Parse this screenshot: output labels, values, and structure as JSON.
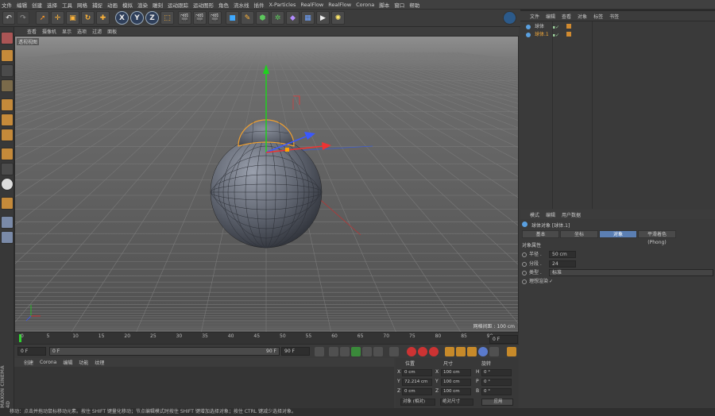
{
  "menu": [
    "文件",
    "编辑",
    "创建",
    "选择",
    "工具",
    "网格",
    "捕捉",
    "动画",
    "模拟",
    "渲染",
    "雕刻",
    "运动跟踪",
    "运动图形",
    "角色",
    "流水线",
    "插件",
    "X-Particles",
    "RealFlow",
    "RealFlow",
    "Corona",
    "脚本",
    "窗口",
    "帮助"
  ],
  "toolbar": {
    "axis_x": "X",
    "axis_y": "Y",
    "axis_z": "Z"
  },
  "viewport": {
    "menu": [
      "查看",
      "摄像机",
      "显示",
      "选项",
      "过滤",
      "面板"
    ],
    "label": "透视视图",
    "grid_spacing": "网格间距 : 100 cm"
  },
  "timeline": {
    "ticks": [
      "0",
      "5",
      "10",
      "15",
      "20",
      "25",
      "30",
      "35",
      "40",
      "45",
      "50",
      "55",
      "60",
      "65",
      "70",
      "75",
      "80",
      "85",
      "90"
    ],
    "end_frame": "0 F"
  },
  "playbar": {
    "start": "0 F",
    "current": "0 F",
    "range_end": "90 F",
    "end": "90 F"
  },
  "material_menu": [
    "创建",
    "Corona",
    "编辑",
    "功能",
    "纹理"
  ],
  "coords": {
    "headers": {
      "pos": "位置",
      "size": "尺寸",
      "rot": "旋转"
    },
    "rows": [
      {
        "axis": "X",
        "pos": "0 cm",
        "saxis": "X",
        "size": "100 cm",
        "raxis": "H",
        "rot": "0 °"
      },
      {
        "axis": "Y",
        "pos": "72.214 cm",
        "saxis": "Y",
        "size": "100 cm",
        "raxis": "P",
        "rot": "0 °"
      },
      {
        "axis": "Z",
        "pos": "0 cm",
        "saxis": "Z",
        "size": "100 cm",
        "raxis": "B",
        "rot": "0 °"
      }
    ],
    "mode": "对象 (相对)",
    "size_mode": "绝对尺寸",
    "apply": "应用"
  },
  "object_manager": {
    "menu": [
      "文件",
      "编辑",
      "查看",
      "对象",
      "标签",
      "书签"
    ],
    "objects": [
      {
        "name": "球体",
        "selected": false
      },
      {
        "name": "球体.1",
        "selected": true
      }
    ]
  },
  "attributes": {
    "menu": [
      "模式",
      "编辑",
      "用户数据"
    ],
    "title": "球体对象 [球体.1]",
    "tabs": [
      "基本",
      "坐标",
      "对象",
      "平滑着色(Phong)"
    ],
    "section": "对象属性",
    "props": [
      {
        "label": "半径 .",
        "value": "50 cm"
      },
      {
        "label": "分段 .",
        "value": "24"
      },
      {
        "label": "类型 .",
        "value": "标准"
      },
      {
        "label": "理想渲染",
        "value": "✓"
      }
    ]
  },
  "status": "移动：点击并拖动鼠标移动元素。按住 SHIFT 键量化移动；节点编辑模式时按住 SHIFT 键增加选择对象；按住 CTRL 键减少选择对象。",
  "brand": "MAXON CINEMA 4D"
}
